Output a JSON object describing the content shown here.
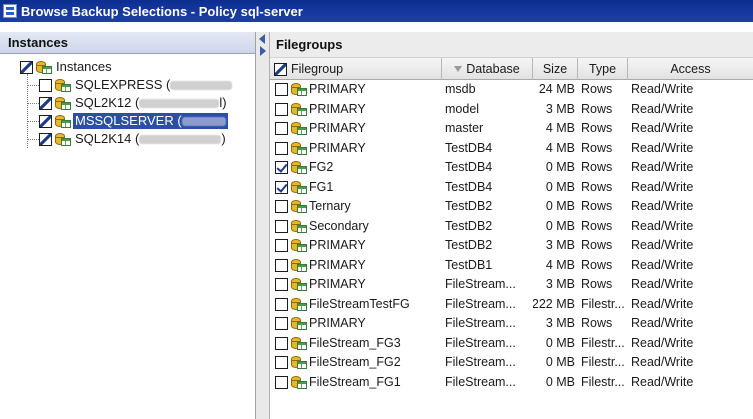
{
  "window": {
    "title": "Browse Backup Selections - Policy sql-server"
  },
  "left_panel": {
    "header": "Instances",
    "tree": [
      {
        "label": "Instances",
        "check": "partial",
        "selected": false
      },
      {
        "label": "SQLEXPRESS (",
        "check": "unchecked",
        "selected": false
      },
      {
        "label": "SQL2K12 (",
        "suffix": "l)",
        "check": "partial",
        "selected": false
      },
      {
        "label": "MSSQLSERVER (",
        "check": "partial",
        "selected": true
      },
      {
        "label": "SQL2K14 (",
        "suffix": ")",
        "check": "partial",
        "selected": false
      }
    ]
  },
  "right_panel": {
    "header": "Filegroups",
    "columns": {
      "filegroup": "Filegroup",
      "database": "Database",
      "size": "Size",
      "type": "Type",
      "access": "Access"
    },
    "rows": [
      {
        "filegroup": "PRIMARY",
        "database": "msdb",
        "size": "24 MB",
        "type": "Rows",
        "access": "Read/Write",
        "checked": false
      },
      {
        "filegroup": "PRIMARY",
        "database": "model",
        "size": "3 MB",
        "type": "Rows",
        "access": "Read/Write",
        "checked": false
      },
      {
        "filegroup": "PRIMARY",
        "database": "master",
        "size": "4 MB",
        "type": "Rows",
        "access": "Read/Write",
        "checked": false
      },
      {
        "filegroup": "PRIMARY",
        "database": "TestDB4",
        "size": "4 MB",
        "type": "Rows",
        "access": "Read/Write",
        "checked": false
      },
      {
        "filegroup": "FG2",
        "database": "TestDB4",
        "size": "0 MB",
        "type": "Rows",
        "access": "Read/Write",
        "checked": true
      },
      {
        "filegroup": "FG1",
        "database": "TestDB4",
        "size": "0 MB",
        "type": "Rows",
        "access": "Read/Write",
        "checked": true
      },
      {
        "filegroup": "Ternary",
        "database": "TestDB2",
        "size": "0 MB",
        "type": "Rows",
        "access": "Read/Write",
        "checked": false
      },
      {
        "filegroup": "Secondary",
        "database": "TestDB2",
        "size": "0 MB",
        "type": "Rows",
        "access": "Read/Write",
        "checked": false
      },
      {
        "filegroup": "PRIMARY",
        "database": "TestDB2",
        "size": "3 MB",
        "type": "Rows",
        "access": "Read/Write",
        "checked": false
      },
      {
        "filegroup": "PRIMARY",
        "database": "TestDB1",
        "size": "4 MB",
        "type": "Rows",
        "access": "Read/Write",
        "checked": false
      },
      {
        "filegroup": "PRIMARY",
        "database": "FileStream...",
        "size": "3 MB",
        "type": "Rows",
        "access": "Read/Write",
        "checked": false
      },
      {
        "filegroup": "FileStreamTestFG",
        "database": "FileStream...",
        "size": "222 MB",
        "type": "Filestr...",
        "access": "Read/Write",
        "checked": false
      },
      {
        "filegroup": "PRIMARY",
        "database": "FileStream...",
        "size": "3 MB",
        "type": "Rows",
        "access": "Read/Write",
        "checked": false
      },
      {
        "filegroup": "FileStream_FG3",
        "database": "FileStream...",
        "size": "0 MB",
        "type": "Filestr...",
        "access": "Read/Write",
        "checked": false
      },
      {
        "filegroup": "FileStream_FG2",
        "database": "FileStream...",
        "size": "0 MB",
        "type": "Filestr...",
        "access": "Read/Write",
        "checked": false
      },
      {
        "filegroup": "FileStream_FG1",
        "database": "FileStream...",
        "size": "0 MB",
        "type": "Filestr...",
        "access": "Read/Write",
        "checked": false
      }
    ]
  },
  "colors": {
    "title_bar": "#1e3ea6",
    "selection": "#2b4fa8",
    "checkmark": "#1b3b8a",
    "db_icon": "#e9b624"
  }
}
